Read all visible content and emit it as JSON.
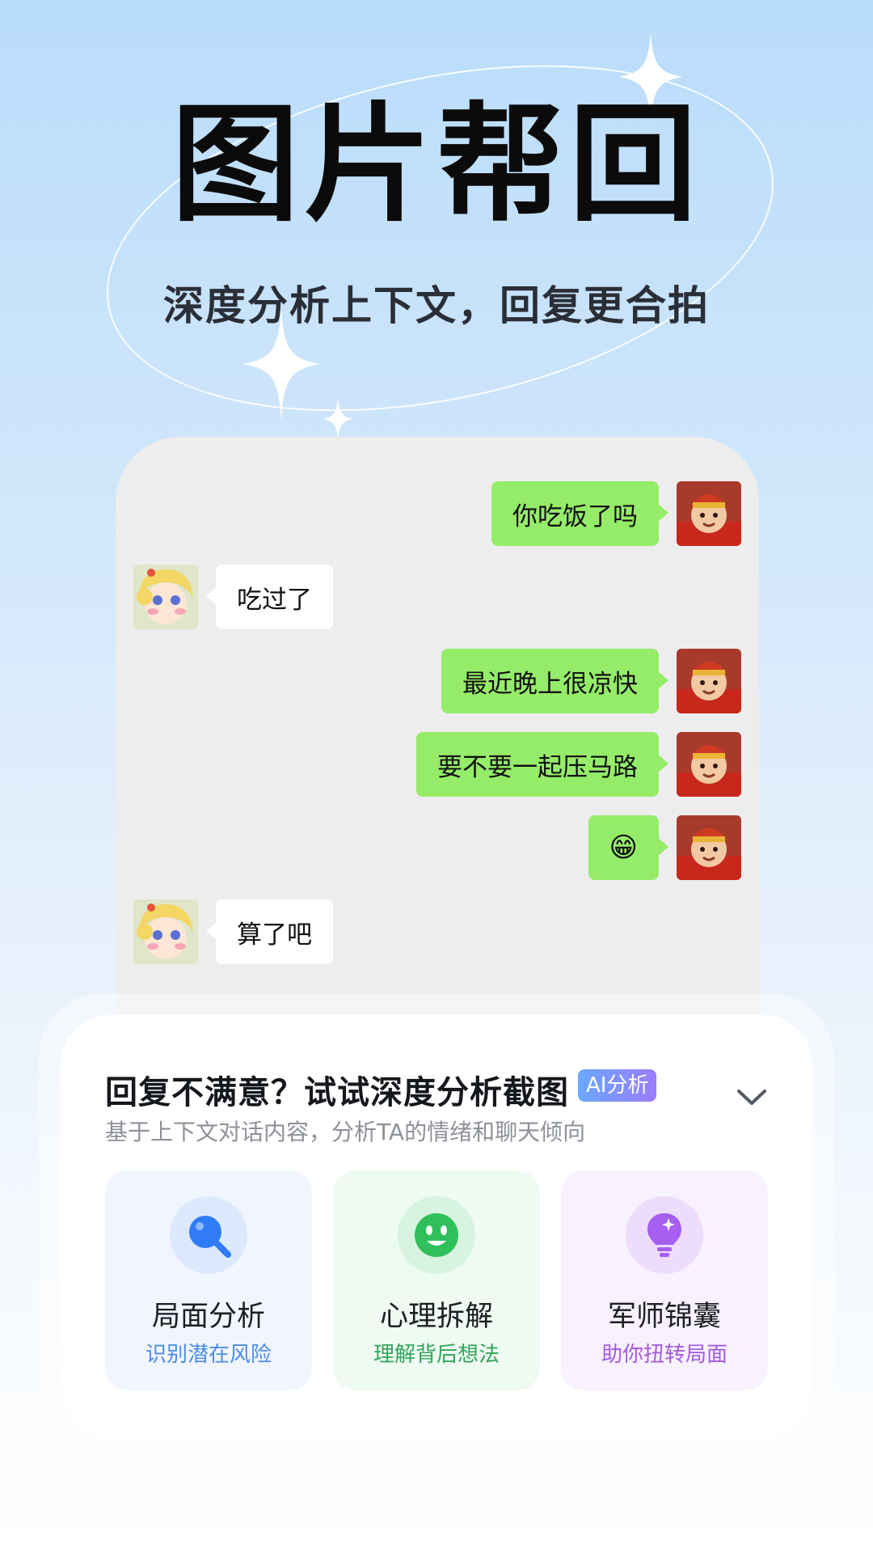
{
  "hero": {
    "title": "图片帮回",
    "subtitle": "深度分析上下文，回复更合拍"
  },
  "chat": {
    "messages": [
      {
        "side": "right",
        "text": "你吃饭了吗"
      },
      {
        "side": "left",
        "text": "吃过了"
      },
      {
        "side": "right",
        "text": "最近晚上很凉快"
      },
      {
        "side": "right",
        "text": "要不要一起压马路"
      },
      {
        "side": "right",
        "text": "😁"
      },
      {
        "side": "left",
        "text": "算了吧"
      }
    ]
  },
  "panel": {
    "title": "回复不满意？试试深度分析截图",
    "badge": "AI分析",
    "description": "基于上下文对话内容，分析TA的情绪和聊天倾向",
    "features": [
      {
        "title": "局面分析",
        "subtitle": "识别潜在风险",
        "icon": "search-icon",
        "accent": "#2f7cf6"
      },
      {
        "title": "心理拆解",
        "subtitle": "理解背后想法",
        "icon": "smile-icon",
        "accent": "#2fc05c"
      },
      {
        "title": "军师锦囊",
        "subtitle": "助你扭转局面",
        "icon": "lightbulb-icon",
        "accent": "#a65ff0"
      }
    ]
  },
  "colors": {
    "green_bubble": "#95ec69",
    "chat_background": "#ededed",
    "badge_gradient": [
      "#6aa8ff",
      "#9b7cff"
    ]
  }
}
